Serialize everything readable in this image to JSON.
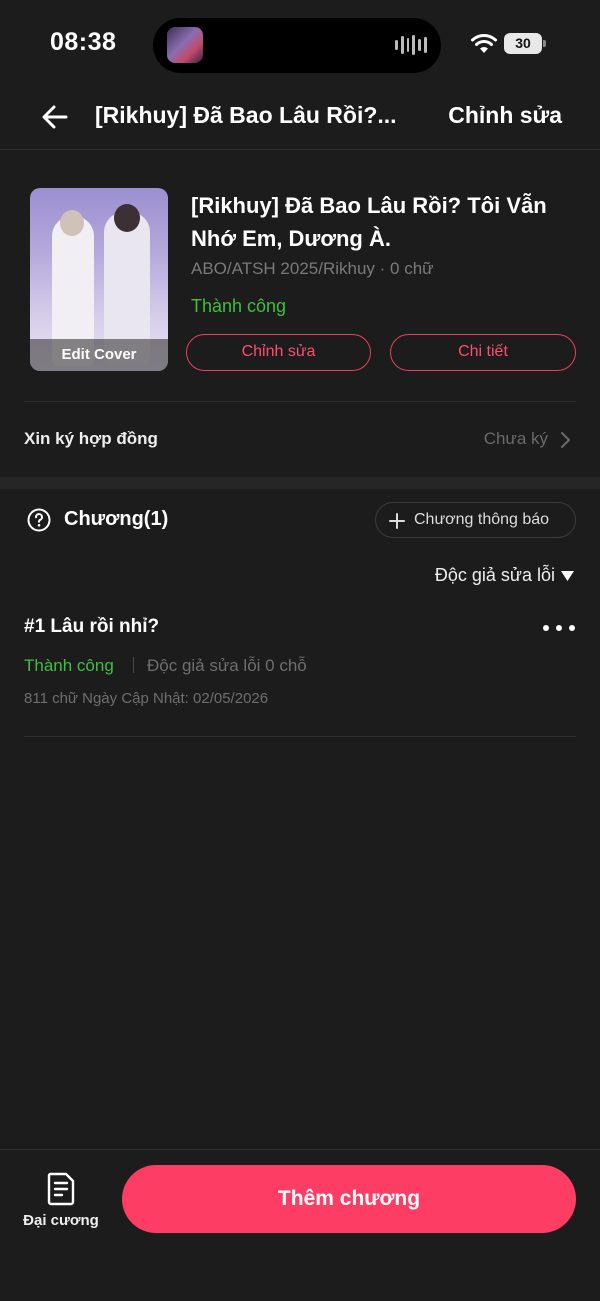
{
  "status_bar": {
    "time": "08:38",
    "battery": "30"
  },
  "nav": {
    "title": "[Rikhuy] Đã Bao Lâu Rồi?...",
    "edit_label": "Chỉnh sửa"
  },
  "book": {
    "cover_label": "Edit Cover",
    "title": "[Rikhuy] Đã Bao Lâu Rồi? Tôi Vẫn Nhớ Em, Dương À.",
    "meta": "ABO/ATSH 2025/Rikhuy · 0 chữ",
    "status": "Thành công",
    "edit_button": "Chỉnh sửa",
    "detail_button": "Chi tiết"
  },
  "contract": {
    "label": "Xin ký hợp đồng",
    "value": "Chưa ký"
  },
  "chapters": {
    "title": "Chương(1)",
    "announce_button": "Chương thông báo",
    "filter": "Độc giả sửa lỗi",
    "items": [
      {
        "title": "#1 Lâu rồi nhỉ?",
        "status": "Thành công",
        "errors": "Độc giả sửa lỗi 0 chỗ",
        "updated": "811 chữ Ngày Cập Nhật: 02/05/2026"
      }
    ]
  },
  "bottom": {
    "outline_label": "Đại cương",
    "add_chapter": "Thêm chương"
  },
  "colors": {
    "accent": "#fe3d64",
    "success": "#3fbf3f",
    "background": "#1c1c1c"
  },
  "icons": [
    "back-arrow-icon",
    "wifi-icon",
    "battery-icon",
    "help-icon",
    "plus-icon",
    "caret-down-icon",
    "more-icon",
    "chevron-right-icon",
    "document-icon"
  ]
}
